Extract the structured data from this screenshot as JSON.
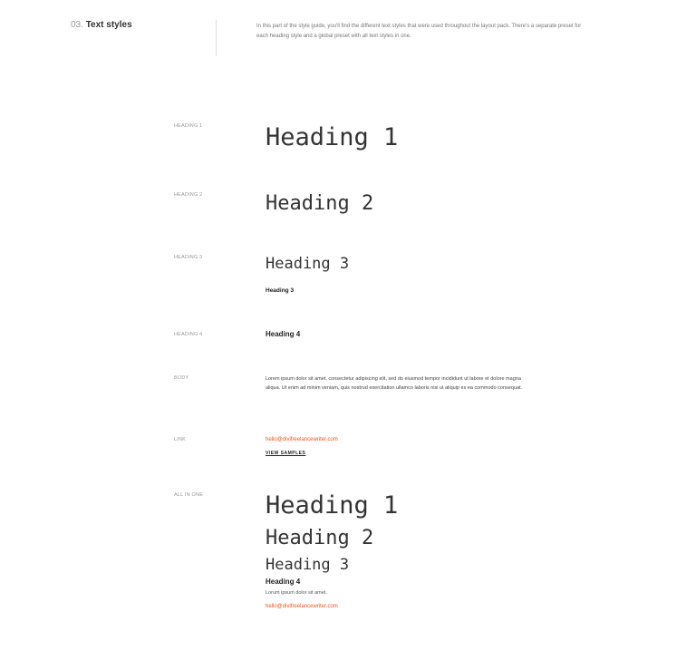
{
  "section": {
    "number": "03.",
    "title": "Text styles",
    "intro": "In this part of the style guide, you'll find the different text styles that were used throughout the layout pack. There's a separate preset for each heading style and a global preset with all text styles in one."
  },
  "rows": {
    "heading1": {
      "label": "HEADING 1",
      "sample": "Heading 1"
    },
    "heading2": {
      "label": "HEADING 2",
      "sample": "Heading 2"
    },
    "heading3": {
      "label": "HEADING 3",
      "sample": "Heading 3",
      "sample_small": "Heading 3"
    },
    "heading4": {
      "label": "HEADING 4",
      "sample": "Heading 4"
    },
    "body": {
      "label": "BODY",
      "text": "Lorem ipsum dolor sit amet, consectetur adipiscing elit, sed do eiusmod tempor incididunt ut labore et dolore magna aliqua. Ut enim ad minim veniam, quis nostrud exercitation ullamco laboris nisi ut aliquip ex ea commodo consequat."
    },
    "link": {
      "label": "LINK",
      "email": "hello@divifreelancewriter.com",
      "cta": "VIEW SAMPLES"
    },
    "all_in_one": {
      "label": "ALL IN ONE",
      "h1": "Heading 1",
      "h2": "Heading 2",
      "h3": "Heading 3",
      "h4": "Heading 4",
      "body": "Lorum ipsum dolor sit amet.",
      "email": "hello@divifreelancewriter.com"
    }
  },
  "colors": {
    "accent": "#f0561d",
    "text": "#333333",
    "muted": "#999999"
  }
}
